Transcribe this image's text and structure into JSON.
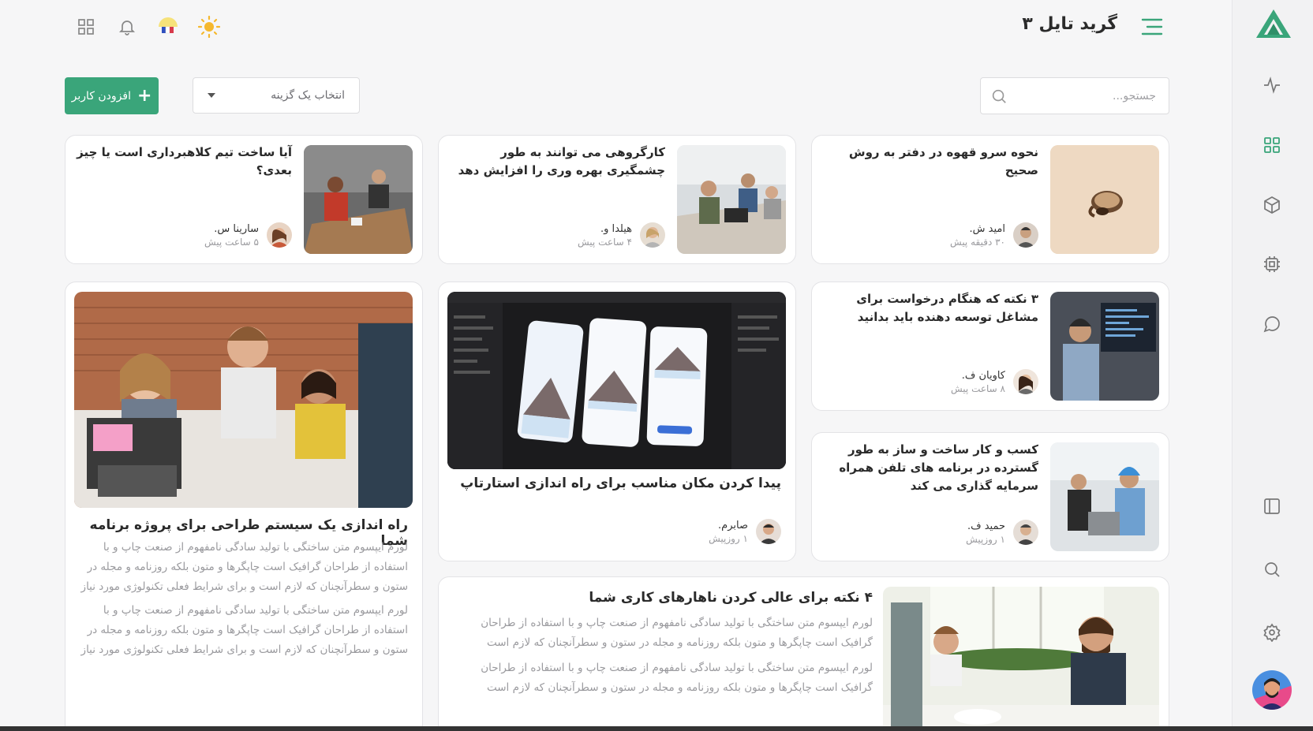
{
  "header": {
    "title": "گرید تایل ۳"
  },
  "toolbar": {
    "search_placeholder": "جستجو...",
    "select_placeholder": "انتخاب یک گزینه",
    "add_label": "افزودن کاربر"
  },
  "cards": [
    {
      "title": "نحوه سرو قهوه در دفتر به روش صحیح",
      "author": "امید ش.",
      "time": "۳۰ دقیقه پیش"
    },
    {
      "title": "کارگروهی می توانند به طور چشمگیری بهره وری را افزایش دهد",
      "author": "هیلدا و.",
      "time": "۴ ساعت پیش"
    },
    {
      "title": "آیا ساخت تیم کلاهبرداری است یا چیز بعدی؟",
      "author": "سارینا س.",
      "time": "۵ ساعت پیش"
    },
    {
      "title": "۳ نکته که هنگام درخواست برای مشاغل توسعه دهنده باید بدانید",
      "author": "کاویان ف.",
      "time": "۸ ساعت پیش"
    },
    {
      "title": "کسب و کار ساخت و ساز به طور گسترده در برنامه های تلفن همراه سرمایه گذاری می کند",
      "author": "حمید ف.",
      "time": "۱ روزپیش"
    },
    {
      "title": "پیدا کردن مکان مناسب برای راه اندازی استارتاپ",
      "author": "صابرم.",
      "time": "۱ روزپیش"
    }
  ],
  "feature_left": {
    "title": "راه اندازی یک سیستم طراحی برای پروژه برنامه شما",
    "paragraphs": [
      "لورم ایپسوم متن ساختگی با تولید سادگی نامفهوم از صنعت چاپ و با استفاده از طراحان گرافیک است چاپگرها و متون بلکه روزنامه و مجله در ستون و سطرآنچنان که لازم است و برای شرایط فعلی تکنولوژی مورد نیاز",
      "لورم ایپسوم متن ساختگی با تولید سادگی نامفهوم از صنعت چاپ و با استفاده از طراحان گرافیک است چاپگرها و متون بلکه روزنامه و مجله در ستون و سطرآنچنان که لازم است و برای شرایط فعلی تکنولوژی مورد نیاز"
    ]
  },
  "feature_bottom": {
    "title": "۴ نکته برای عالی کردن ناهارهای کاری شما",
    "paragraphs": [
      "لورم ایپسوم متن ساختگی با تولید سادگی نامفهوم از صنعت چاپ و با استفاده از طراحان گرافیک است چاپگرها و متون بلکه روزنامه و مجله در ستون و سطرآنچنان که لازم است",
      "لورم ایپسوم متن ساختگی با تولید سادگی نامفهوم از صنعت چاپ و با استفاده از طراحان گرافیک است چاپگرها و متون بلکه روزنامه و مجله در ستون و سطرآنچنان که لازم است"
    ]
  },
  "sidebar": {
    "icons": [
      "activity-icon",
      "grid-icon",
      "box-icon",
      "cpu-icon",
      "chat-icon",
      "layout-icon",
      "search-icon",
      "settings-icon"
    ],
    "active": "grid-icon"
  },
  "colors": {
    "accent": "#3aa57a",
    "background": "#f6f6f7"
  }
}
